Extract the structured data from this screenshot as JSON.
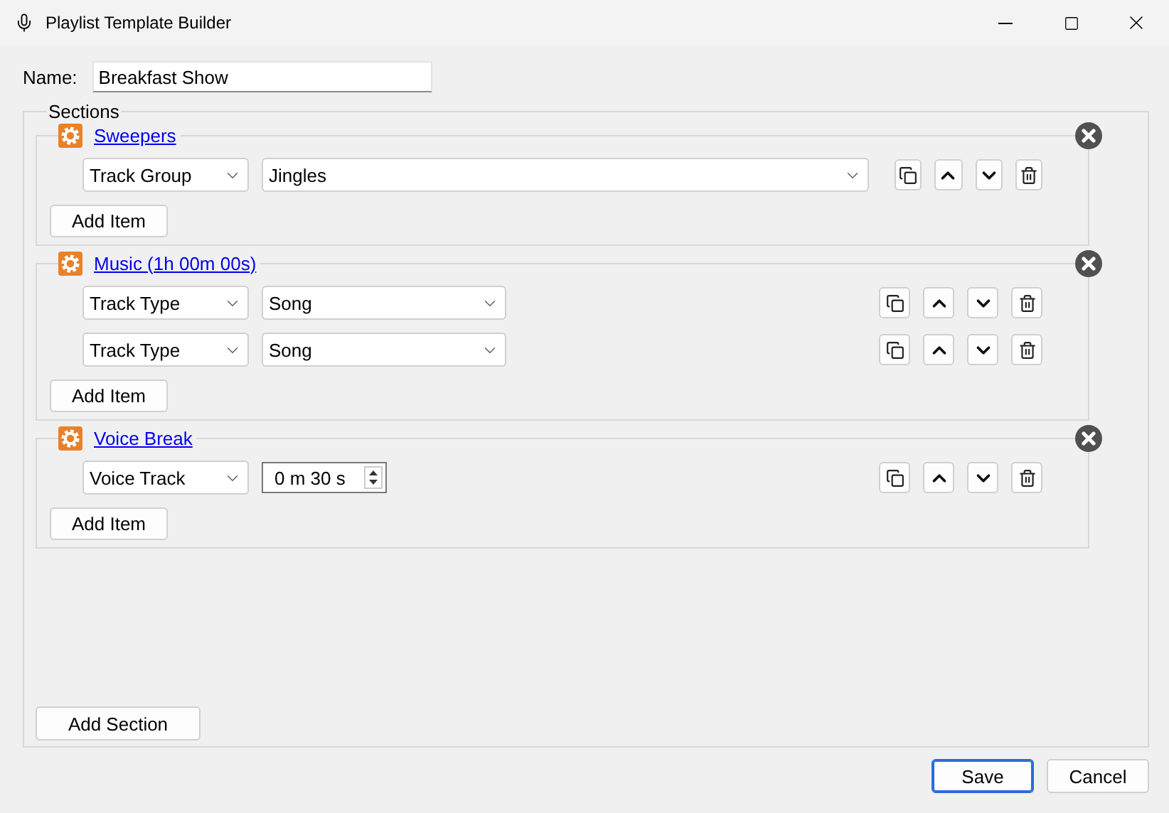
{
  "window": {
    "title": "Playlist Template Builder"
  },
  "name": {
    "label": "Name:",
    "value": "Breakfast Show"
  },
  "sections_group": {
    "label": "Sections",
    "sections": [
      {
        "title": "Sweepers",
        "add_item": "Add Item",
        "items": [
          {
            "kind": "dropdown",
            "source": "Track Group",
            "value": "Jingles",
            "wide": true
          }
        ]
      },
      {
        "title": "Music (1h 00m 00s)",
        "add_item": "Add Item",
        "items": [
          {
            "kind": "dropdown",
            "source": "Track Type",
            "value": "Song",
            "wide": false
          },
          {
            "kind": "dropdown",
            "source": "Track Type",
            "value": "Song",
            "wide": false
          }
        ]
      },
      {
        "title": "Voice Break",
        "add_item": "Add Item",
        "items": [
          {
            "kind": "duration",
            "source": "Voice Track",
            "value": "0 m 30 s"
          }
        ]
      }
    ]
  },
  "add_section": "Add Section",
  "buttons": [
    {
      "label": "Save",
      "default": true
    },
    {
      "label": "Cancel",
      "default": false
    }
  ]
}
